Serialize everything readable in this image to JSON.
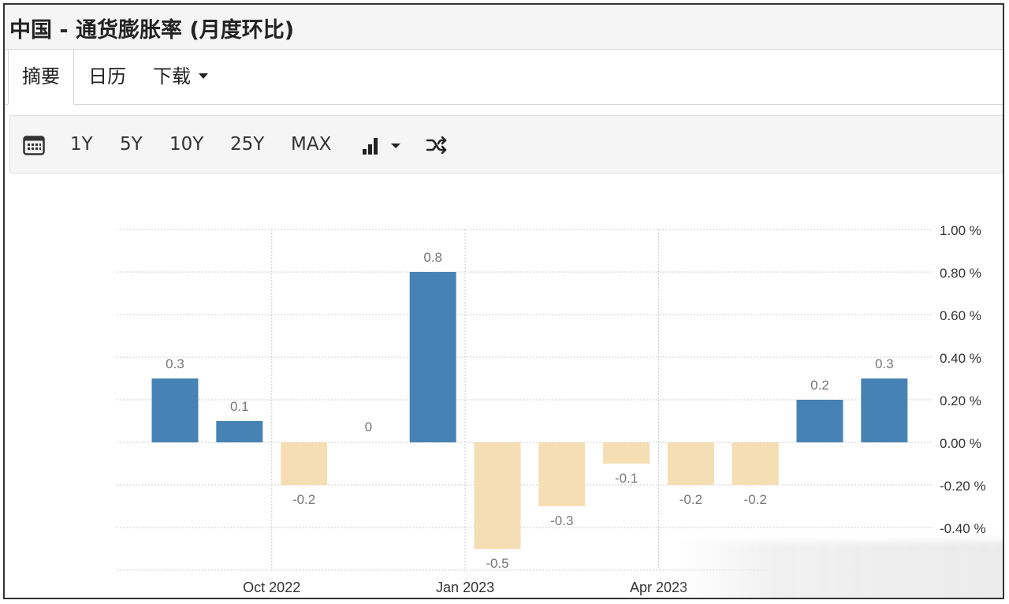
{
  "header": {
    "title": "中国 - 通货膨胀率 (月度环比)"
  },
  "tabs": [
    {
      "label": "摘要",
      "active": true
    },
    {
      "label": "日历",
      "active": false
    },
    {
      "label": "下载",
      "active": false,
      "dropdown": true
    }
  ],
  "toolbar": {
    "calendar_icon": "calendar-icon",
    "ranges": [
      "1Y",
      "5Y",
      "10Y",
      "25Y",
      "MAX"
    ],
    "chart_type_icon": "bar-chart-icon",
    "compare_icon": "shuffle-icon"
  },
  "colors": {
    "positive": "#4682b4",
    "negative": "#f5deb3",
    "grid": "#cccccc",
    "label": "#777777"
  },
  "chart_data": {
    "type": "bar",
    "values": [
      0.3,
      0.1,
      -0.2,
      0,
      0.8,
      -0.5,
      -0.3,
      -0.1,
      -0.2,
      -0.2,
      0.2,
      0.3
    ],
    "data_labels": [
      "0.3",
      "0.1",
      "-0.2",
      "0",
      "0.8",
      "-0.5",
      "-0.3",
      "-0.1",
      "-0.2",
      "-0.2",
      "0.2",
      "0.3"
    ],
    "x_tick_labels": [
      {
        "label": "Oct 2022",
        "index": 1.5
      },
      {
        "label": "Jan 2023",
        "index": 4.5
      },
      {
        "label": "Apr 2023",
        "index": 7.5
      }
    ],
    "y_ticks": [
      1.0,
      0.8,
      0.6,
      0.4,
      0.2,
      0.0,
      -0.2,
      -0.4
    ],
    "y_tick_labels": [
      "1.00 %",
      "0.80 %",
      "0.60 %",
      "0.40 %",
      "0.20 %",
      "0.00 %",
      "-0.20 %",
      "-0.40 %"
    ],
    "ylim": [
      -0.6,
      1.0
    ],
    "axis_side": "right",
    "grid": true
  }
}
